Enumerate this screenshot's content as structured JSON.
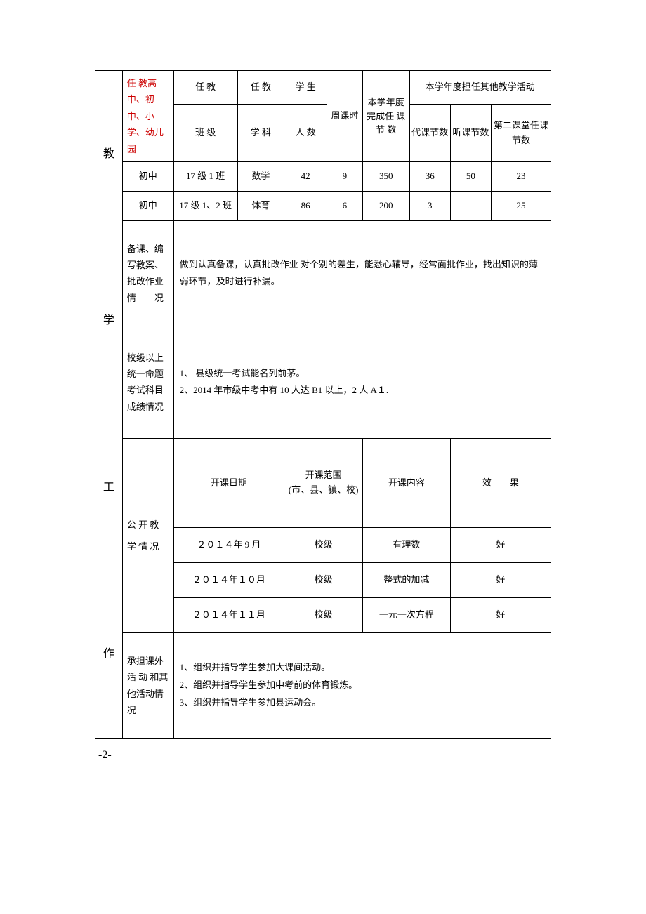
{
  "sideLabel": {
    "c1": "教",
    "c2": "学",
    "c3": "工",
    "c4": "作"
  },
  "headers": {
    "schoolType": "任 教高中、初中、小学、幼儿园",
    "class": "任 教",
    "class2": "班 级",
    "subject": "任 教",
    "subject2": "学 科",
    "students": "学 生",
    "students2": "人 数",
    "weekly": "周课时",
    "completed": "本学年度完成任 课节 数",
    "otherActivities": "本学年度担任其他教学活动",
    "sub1": "代课节数",
    "sub2": "听课节数",
    "sub3": "第二课堂任课节数"
  },
  "rows": [
    {
      "type": "初中",
      "class": "17 级 1 班",
      "subject": "数学",
      "students": "42",
      "weekly": "9",
      "completed": "350",
      "sub1": "36",
      "sub2": "50",
      "sub3": "23"
    },
    {
      "type": "初中",
      "class": "17 级 1、2 班",
      "subject": "体育",
      "students": "86",
      "weekly": "6",
      "completed": "200",
      "sub1": "3",
      "sub2": "",
      "sub3": "25"
    }
  ],
  "sec1": {
    "label": "备课、编写教案、批改作业情　　况",
    "text": "做到认真备课，认真批改作业 对个别的差生，能悉心辅导，经常面批作业，找出知识的薄弱环节，及时进行补漏。"
  },
  "sec2": {
    "label": "校级以上统一命题考试科目成绩情况",
    "line1": "1、 县级统一考试能名列前茅。",
    "line2": "2、2014 年市级中考中有 10 人达 B1 以上，2 人 A１."
  },
  "sec3": {
    "label": "公 开 教 学 情 况",
    "h1": "开课日期",
    "h2a": "开课范围",
    "h2b": "(市、县、镇、校)",
    "h3": "开课内容",
    "h4": "效　　果",
    "rows": [
      {
        "date": "２０１４年 9 月",
        "scope": "校级",
        "content": "有理数",
        "result": "好"
      },
      {
        "date": "２０１４年１０月",
        "scope": "校级",
        "content": "整式的加减",
        "result": "好"
      },
      {
        "date": "２０１４年１１月",
        "scope": "校级",
        "content": "一元一次方程",
        "result": "好"
      }
    ]
  },
  "sec4": {
    "label": "承担课外活 动 和其他活动情　　况",
    "line1": "1、组织并指导学生参加大课间活动。",
    "line2": "2、组织并指导学生参加中考前的体育锻炼。",
    "line3": "3、组织并指导学生参加县运动会。"
  },
  "pageNum": "-2-"
}
